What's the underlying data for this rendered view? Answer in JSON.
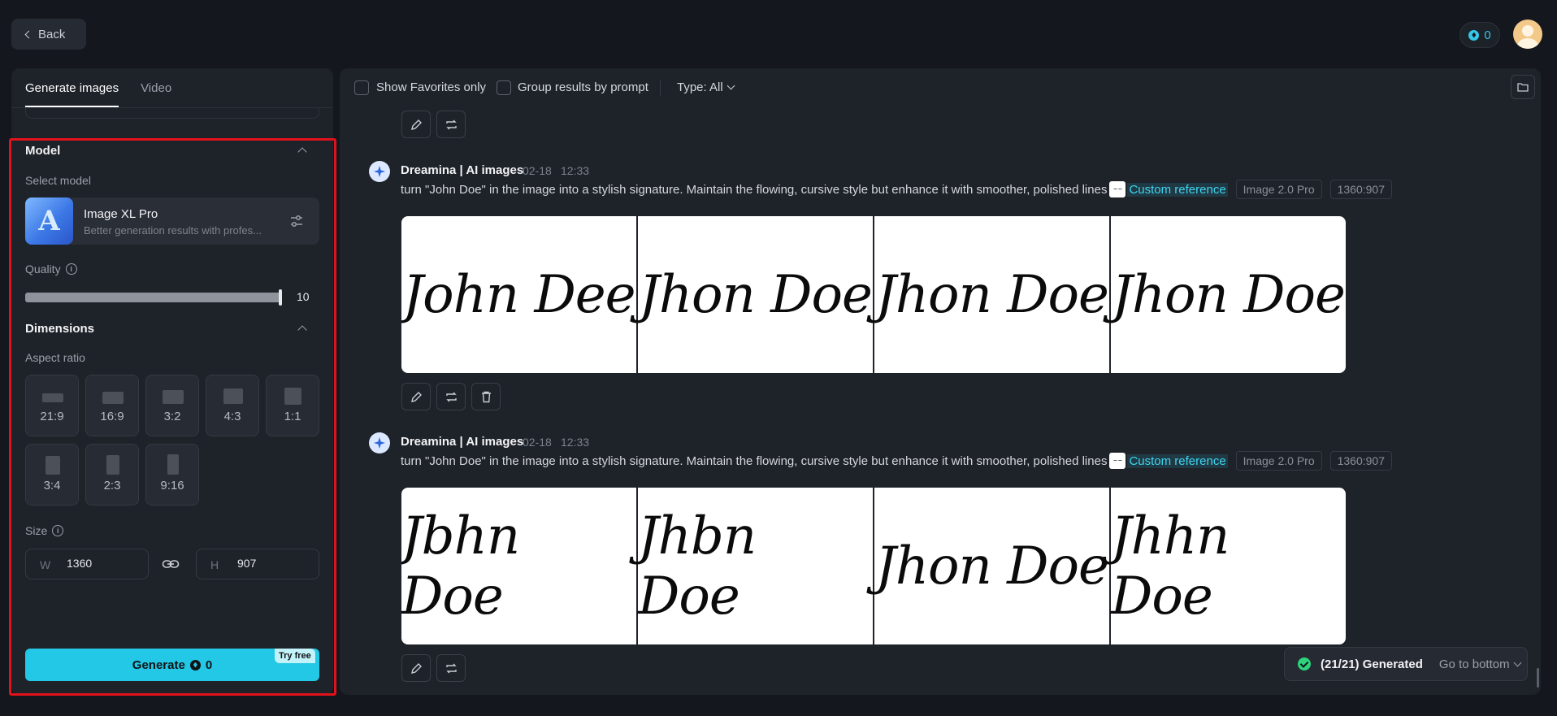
{
  "header": {
    "back_label": "Back",
    "credits": "0"
  },
  "left": {
    "tabs": [
      "Generate images",
      "Video"
    ],
    "model_section": "Model",
    "select_model_label": "Select model",
    "model": {
      "name": "Image XL Pro",
      "description": "Better generation results with profes...",
      "thumb_letter": "A"
    },
    "quality_label": "Quality",
    "quality_value": "10",
    "quality_level": 1.0,
    "dimensions_section": "Dimensions",
    "aspect_ratio_label": "Aspect ratio",
    "ratios": [
      "21:9",
      "16:9",
      "3:2",
      "4:3",
      "1:1",
      "3:4",
      "2:3",
      "9:16"
    ],
    "size_label": "Size",
    "width": {
      "prefix": "W",
      "value": "1360"
    },
    "height": {
      "prefix": "H",
      "value": "907"
    },
    "generate_label": "Generate",
    "generate_cost": "0",
    "try_free": "Try free"
  },
  "filters": {
    "favorites_label": "Show Favorites only",
    "group_label": "Group results by prompt",
    "type_label": "Type: All"
  },
  "results": [
    {
      "author": "Dreamina | AI images",
      "date": "02-18",
      "time": "12:33",
      "prompt": "turn \"John Doe\" in the image into a stylish signature. Maintain the flowing, cursive style but enhance it with smoother, polished lines",
      "reference": "Custom reference",
      "model_tag": "Image 2.0 Pro",
      "size_tag": "1360:907",
      "images": [
        "John Dee",
        "Jhon Doe",
        "Jhon Doe",
        "Jhon Doe"
      ]
    },
    {
      "author": "Dreamina | AI images",
      "date": "02-18",
      "time": "12:33",
      "prompt": "turn \"John Doe\" in the image into a stylish signature. Maintain the flowing, cursive style but enhance it with smoother, polished lines",
      "reference": "Custom reference",
      "model_tag": "Image 2.0 Pro",
      "size_tag": "1360:907",
      "images": [
        "Jbhn Doe",
        "Jhbn Doe",
        "Jhon Doe",
        "Jhhn Doe"
      ]
    }
  ],
  "toast": {
    "status": "(21/21) Generated",
    "link": "Go to bottom"
  },
  "colors": {
    "accent": "#22c8e5",
    "highlight": "#e0121b",
    "success": "#2fd37d"
  }
}
